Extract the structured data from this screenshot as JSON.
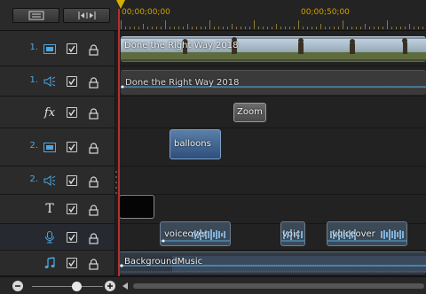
{
  "ruler": {
    "time_start": "00;00;00;00",
    "time_mid": "00;00;50;00"
  },
  "tracks": [
    {
      "num": "1.",
      "kind": "video",
      "icon": "video-track-icon"
    },
    {
      "num": "1.",
      "kind": "audio",
      "icon": "audio-track-icon"
    },
    {
      "num": "",
      "kind": "fx",
      "icon": "fx-track-icon"
    },
    {
      "num": "2.",
      "kind": "video",
      "icon": "video-track-icon"
    },
    {
      "num": "2.",
      "kind": "audio",
      "icon": "audio-track-icon"
    },
    {
      "num": "",
      "kind": "title",
      "icon": "title-track-icon"
    },
    {
      "num": "",
      "kind": "voice",
      "icon": "microphone-icon"
    },
    {
      "num": "",
      "kind": "music",
      "icon": "music-note-icon"
    }
  ],
  "clips": {
    "video1_label": "Done the Right Way 2018",
    "audio1_label": "Done the Right Way 2018",
    "fx_label": "Zoom",
    "video2_label": "balloons",
    "voice1_label": "voiceover",
    "voice2_label": "voic",
    "voice3_label": "voiceover",
    "music_label": "BackgroundMusic"
  },
  "colors": {
    "accent_blue": "#4fa6e0",
    "timecode": "#d0a000",
    "playhead": "#b33030"
  }
}
